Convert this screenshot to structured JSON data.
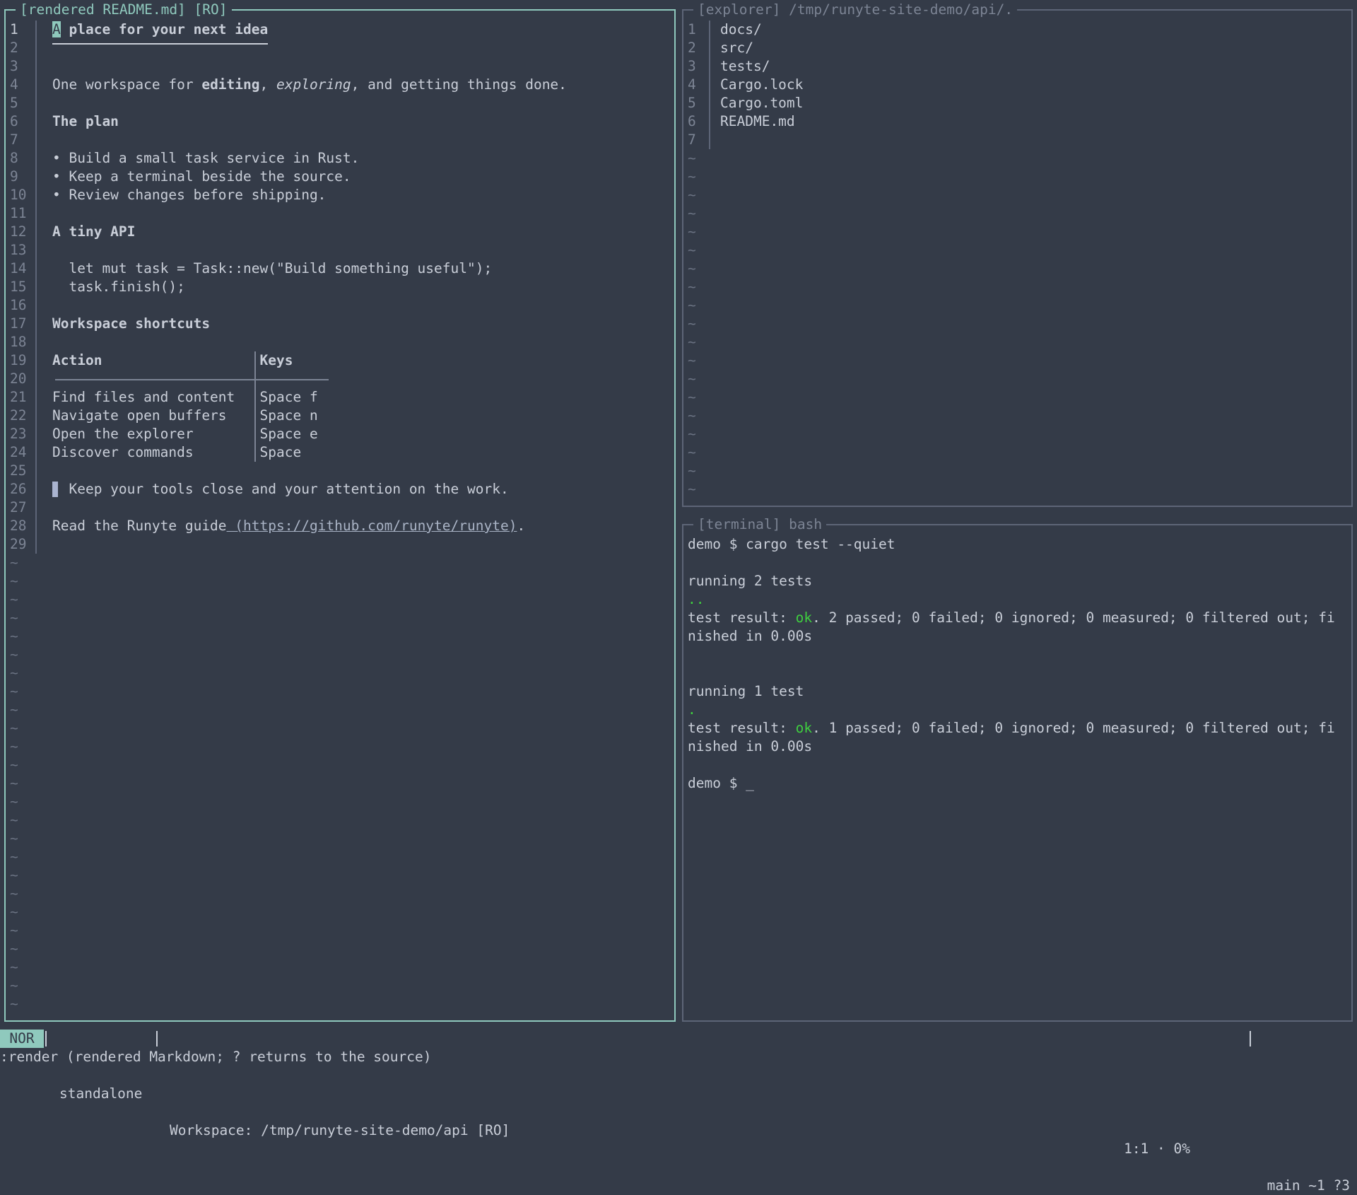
{
  "editor": {
    "title": "[rendered README.md] [RO]",
    "lines": [
      {
        "n": "1",
        "segs": [
          {
            "t": "A",
            "c": "cur"
          },
          {
            "t": " place for your next idea",
            "c": "b"
          }
        ],
        "heading": true
      },
      {
        "n": "2",
        "segs": []
      },
      {
        "n": "3",
        "segs": []
      },
      {
        "n": "4",
        "segs": [
          {
            "t": "One workspace for "
          },
          {
            "t": "editing",
            "c": "b"
          },
          {
            "t": ", "
          },
          {
            "t": "exploring",
            "c": "i"
          },
          {
            "t": ", and getting things done."
          }
        ]
      },
      {
        "n": "5",
        "segs": []
      },
      {
        "n": "6",
        "segs": [
          {
            "t": "The plan",
            "c": "b"
          }
        ]
      },
      {
        "n": "7",
        "segs": []
      },
      {
        "n": "8",
        "segs": [
          {
            "t": "• Build a small task service in Rust."
          }
        ]
      },
      {
        "n": "9",
        "segs": [
          {
            "t": "• Keep a terminal beside the source."
          }
        ]
      },
      {
        "n": "10",
        "segs": [
          {
            "t": "• Review changes before shipping."
          }
        ]
      },
      {
        "n": "11",
        "segs": []
      },
      {
        "n": "12",
        "segs": [
          {
            "t": "A tiny API",
            "c": "b"
          }
        ]
      },
      {
        "n": "13",
        "segs": []
      },
      {
        "n": "14",
        "segs": [
          {
            "t": "  let mut task = Task::new(\"Build something useful\");"
          }
        ]
      },
      {
        "n": "15",
        "segs": [
          {
            "t": "  task.finish();"
          }
        ]
      },
      {
        "n": "16",
        "segs": []
      },
      {
        "n": "17",
        "segs": [
          {
            "t": "Workspace shortcuts",
            "c": "b"
          }
        ]
      },
      {
        "n": "18",
        "segs": []
      },
      {
        "n": "19",
        "segs": [
          {
            "t": "Action                   ",
            "c": "b"
          },
          {
            "t": "Keys",
            "c": "b"
          }
        ],
        "table": "head"
      },
      {
        "n": "20",
        "segs": [],
        "table": "rule"
      },
      {
        "n": "21",
        "segs": [
          {
            "t": "Find files and content   Space f"
          }
        ],
        "table": "row"
      },
      {
        "n": "22",
        "segs": [
          {
            "t": "Navigate open buffers    Space n"
          }
        ],
        "table": "row"
      },
      {
        "n": "23",
        "segs": [
          {
            "t": "Open the explorer        Space e"
          }
        ],
        "table": "row"
      },
      {
        "n": "24",
        "segs": [
          {
            "t": "Discover commands        Space"
          }
        ],
        "table": "row"
      },
      {
        "n": "25",
        "segs": []
      },
      {
        "n": "26",
        "segs": [
          {
            "t": "  Keep your tools close and your attention on the work."
          }
        ],
        "quote": true
      },
      {
        "n": "27",
        "segs": []
      },
      {
        "n": "28",
        "segs": [
          {
            "t": "Read the Runyte guide"
          },
          {
            "t": " (https://github.com/runyte/runyte)",
            "c": "link"
          },
          {
            "t": "."
          }
        ]
      },
      {
        "n": "29",
        "segs": []
      }
    ],
    "tilde_count": 25
  },
  "explorer": {
    "title": "[explorer] /tmp/runyte-site-demo/api/.",
    "items": [
      {
        "n": "1",
        "name": "docs/"
      },
      {
        "n": "2",
        "name": "src/"
      },
      {
        "n": "3",
        "name": "tests/"
      },
      {
        "n": "4",
        "name": "Cargo.lock"
      },
      {
        "n": "5",
        "name": "Cargo.toml"
      },
      {
        "n": "6",
        "name": "README.md"
      },
      {
        "n": "7",
        "name": ""
      }
    ],
    "tilde_count": 19
  },
  "terminal": {
    "title": "[terminal] bash",
    "lines": [
      [
        {
          "t": "demo $ cargo test --quiet"
        }
      ],
      [],
      [
        {
          "t": "running 2 tests"
        }
      ],
      [
        {
          "t": "..",
          "c": "green"
        }
      ],
      [
        {
          "t": "test result: "
        },
        {
          "t": "ok",
          "c": "green"
        },
        {
          "t": ". 2 passed; 0 failed; 0 ignored; 0 measured; 0 filtered out; fi"
        }
      ],
      [
        {
          "t": "nished in 0.00s"
        }
      ],
      [],
      [],
      [
        {
          "t": "running 1 test"
        }
      ],
      [
        {
          "t": ".",
          "c": "green"
        }
      ],
      [
        {
          "t": "test result: "
        },
        {
          "t": "ok",
          "c": "green"
        },
        {
          "t": ". 1 passed; 0 failed; 0 ignored; 0 measured; 0 filtered out; fi"
        }
      ],
      [
        {
          "t": "nished in 0.00s"
        }
      ],
      [],
      [
        {
          "t": "demo $ _"
        }
      ]
    ]
  },
  "status": {
    "mode": "NOR",
    "profile": "standalone",
    "workspace": "Workspace: /tmp/runyte-site-demo/api [RO]",
    "position": "1:1 · 0%",
    "git": "main ~1 ?3"
  },
  "command_line": ":render (rendered Markdown; ? returns to the source)",
  "colors": {
    "background": "#343b48",
    "accent": "#8fc9bd",
    "ok": "#3fcf3f"
  }
}
